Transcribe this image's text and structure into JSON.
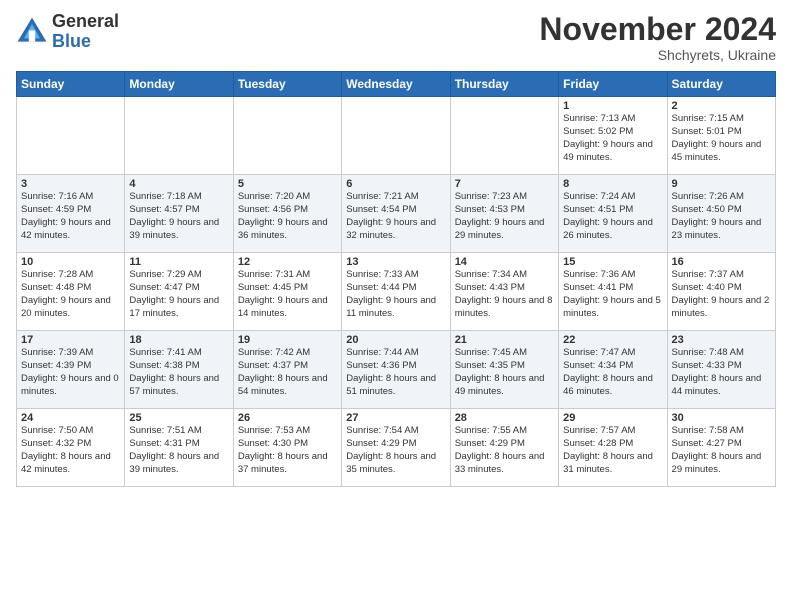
{
  "logo": {
    "general": "General",
    "blue": "Blue"
  },
  "title": "November 2024",
  "location": "Shchyrets, Ukraine",
  "weekdays": [
    "Sunday",
    "Monday",
    "Tuesday",
    "Wednesday",
    "Thursday",
    "Friday",
    "Saturday"
  ],
  "weeks": [
    [
      {
        "day": "",
        "info": ""
      },
      {
        "day": "",
        "info": ""
      },
      {
        "day": "",
        "info": ""
      },
      {
        "day": "",
        "info": ""
      },
      {
        "day": "",
        "info": ""
      },
      {
        "day": "1",
        "info": "Sunrise: 7:13 AM\nSunset: 5:02 PM\nDaylight: 9 hours\nand 49 minutes."
      },
      {
        "day": "2",
        "info": "Sunrise: 7:15 AM\nSunset: 5:01 PM\nDaylight: 9 hours\nand 45 minutes."
      }
    ],
    [
      {
        "day": "3",
        "info": "Sunrise: 7:16 AM\nSunset: 4:59 PM\nDaylight: 9 hours\nand 42 minutes."
      },
      {
        "day": "4",
        "info": "Sunrise: 7:18 AM\nSunset: 4:57 PM\nDaylight: 9 hours\nand 39 minutes."
      },
      {
        "day": "5",
        "info": "Sunrise: 7:20 AM\nSunset: 4:56 PM\nDaylight: 9 hours\nand 36 minutes."
      },
      {
        "day": "6",
        "info": "Sunrise: 7:21 AM\nSunset: 4:54 PM\nDaylight: 9 hours\nand 32 minutes."
      },
      {
        "day": "7",
        "info": "Sunrise: 7:23 AM\nSunset: 4:53 PM\nDaylight: 9 hours\nand 29 minutes."
      },
      {
        "day": "8",
        "info": "Sunrise: 7:24 AM\nSunset: 4:51 PM\nDaylight: 9 hours\nand 26 minutes."
      },
      {
        "day": "9",
        "info": "Sunrise: 7:26 AM\nSunset: 4:50 PM\nDaylight: 9 hours\nand 23 minutes."
      }
    ],
    [
      {
        "day": "10",
        "info": "Sunrise: 7:28 AM\nSunset: 4:48 PM\nDaylight: 9 hours\nand 20 minutes."
      },
      {
        "day": "11",
        "info": "Sunrise: 7:29 AM\nSunset: 4:47 PM\nDaylight: 9 hours\nand 17 minutes."
      },
      {
        "day": "12",
        "info": "Sunrise: 7:31 AM\nSunset: 4:45 PM\nDaylight: 9 hours\nand 14 minutes."
      },
      {
        "day": "13",
        "info": "Sunrise: 7:33 AM\nSunset: 4:44 PM\nDaylight: 9 hours\nand 11 minutes."
      },
      {
        "day": "14",
        "info": "Sunrise: 7:34 AM\nSunset: 4:43 PM\nDaylight: 9 hours\nand 8 minutes."
      },
      {
        "day": "15",
        "info": "Sunrise: 7:36 AM\nSunset: 4:41 PM\nDaylight: 9 hours\nand 5 minutes."
      },
      {
        "day": "16",
        "info": "Sunrise: 7:37 AM\nSunset: 4:40 PM\nDaylight: 9 hours\nand 2 minutes."
      }
    ],
    [
      {
        "day": "17",
        "info": "Sunrise: 7:39 AM\nSunset: 4:39 PM\nDaylight: 9 hours\nand 0 minutes."
      },
      {
        "day": "18",
        "info": "Sunrise: 7:41 AM\nSunset: 4:38 PM\nDaylight: 8 hours\nand 57 minutes."
      },
      {
        "day": "19",
        "info": "Sunrise: 7:42 AM\nSunset: 4:37 PM\nDaylight: 8 hours\nand 54 minutes."
      },
      {
        "day": "20",
        "info": "Sunrise: 7:44 AM\nSunset: 4:36 PM\nDaylight: 8 hours\nand 51 minutes."
      },
      {
        "day": "21",
        "info": "Sunrise: 7:45 AM\nSunset: 4:35 PM\nDaylight: 8 hours\nand 49 minutes."
      },
      {
        "day": "22",
        "info": "Sunrise: 7:47 AM\nSunset: 4:34 PM\nDaylight: 8 hours\nand 46 minutes."
      },
      {
        "day": "23",
        "info": "Sunrise: 7:48 AM\nSunset: 4:33 PM\nDaylight: 8 hours\nand 44 minutes."
      }
    ],
    [
      {
        "day": "24",
        "info": "Sunrise: 7:50 AM\nSunset: 4:32 PM\nDaylight: 8 hours\nand 42 minutes."
      },
      {
        "day": "25",
        "info": "Sunrise: 7:51 AM\nSunset: 4:31 PM\nDaylight: 8 hours\nand 39 minutes."
      },
      {
        "day": "26",
        "info": "Sunrise: 7:53 AM\nSunset: 4:30 PM\nDaylight: 8 hours\nand 37 minutes."
      },
      {
        "day": "27",
        "info": "Sunrise: 7:54 AM\nSunset: 4:29 PM\nDaylight: 8 hours\nand 35 minutes."
      },
      {
        "day": "28",
        "info": "Sunrise: 7:55 AM\nSunset: 4:29 PM\nDaylight: 8 hours\nand 33 minutes."
      },
      {
        "day": "29",
        "info": "Sunrise: 7:57 AM\nSunset: 4:28 PM\nDaylight: 8 hours\nand 31 minutes."
      },
      {
        "day": "30",
        "info": "Sunrise: 7:58 AM\nSunset: 4:27 PM\nDaylight: 8 hours\nand 29 minutes."
      }
    ]
  ]
}
